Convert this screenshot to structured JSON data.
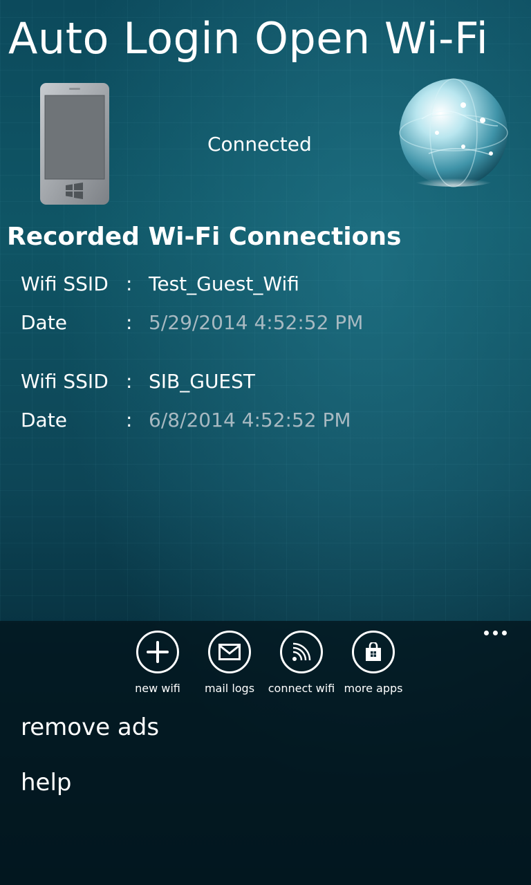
{
  "header": {
    "title": "Auto Login Open Wi-Fi"
  },
  "status": {
    "text": "Connected",
    "phone_icon": "windows-phone-icon",
    "globe_icon": "globe-icon"
  },
  "connections": {
    "title": "Recorded Wi-Fi Connections",
    "separator": ":",
    "ssid_label": "Wifi SSID",
    "date_label": "Date",
    "items": [
      {
        "ssid": "Test_Guest_Wifi",
        "date": "5/29/2014 4:52:52 PM"
      },
      {
        "ssid": "SIB_GUEST",
        "date": "6/8/2014 4:52:52 PM"
      }
    ]
  },
  "appbar": {
    "more_icon": "ellipsis-icon",
    "buttons": [
      {
        "label": "new wifi",
        "icon": "add-icon"
      },
      {
        "label": "mail logs",
        "icon": "mail-icon"
      },
      {
        "label": "connect wifi",
        "icon": "wifi-icon"
      },
      {
        "label": "more apps",
        "icon": "store-icon"
      }
    ],
    "menu": [
      "remove ads",
      "help"
    ]
  }
}
